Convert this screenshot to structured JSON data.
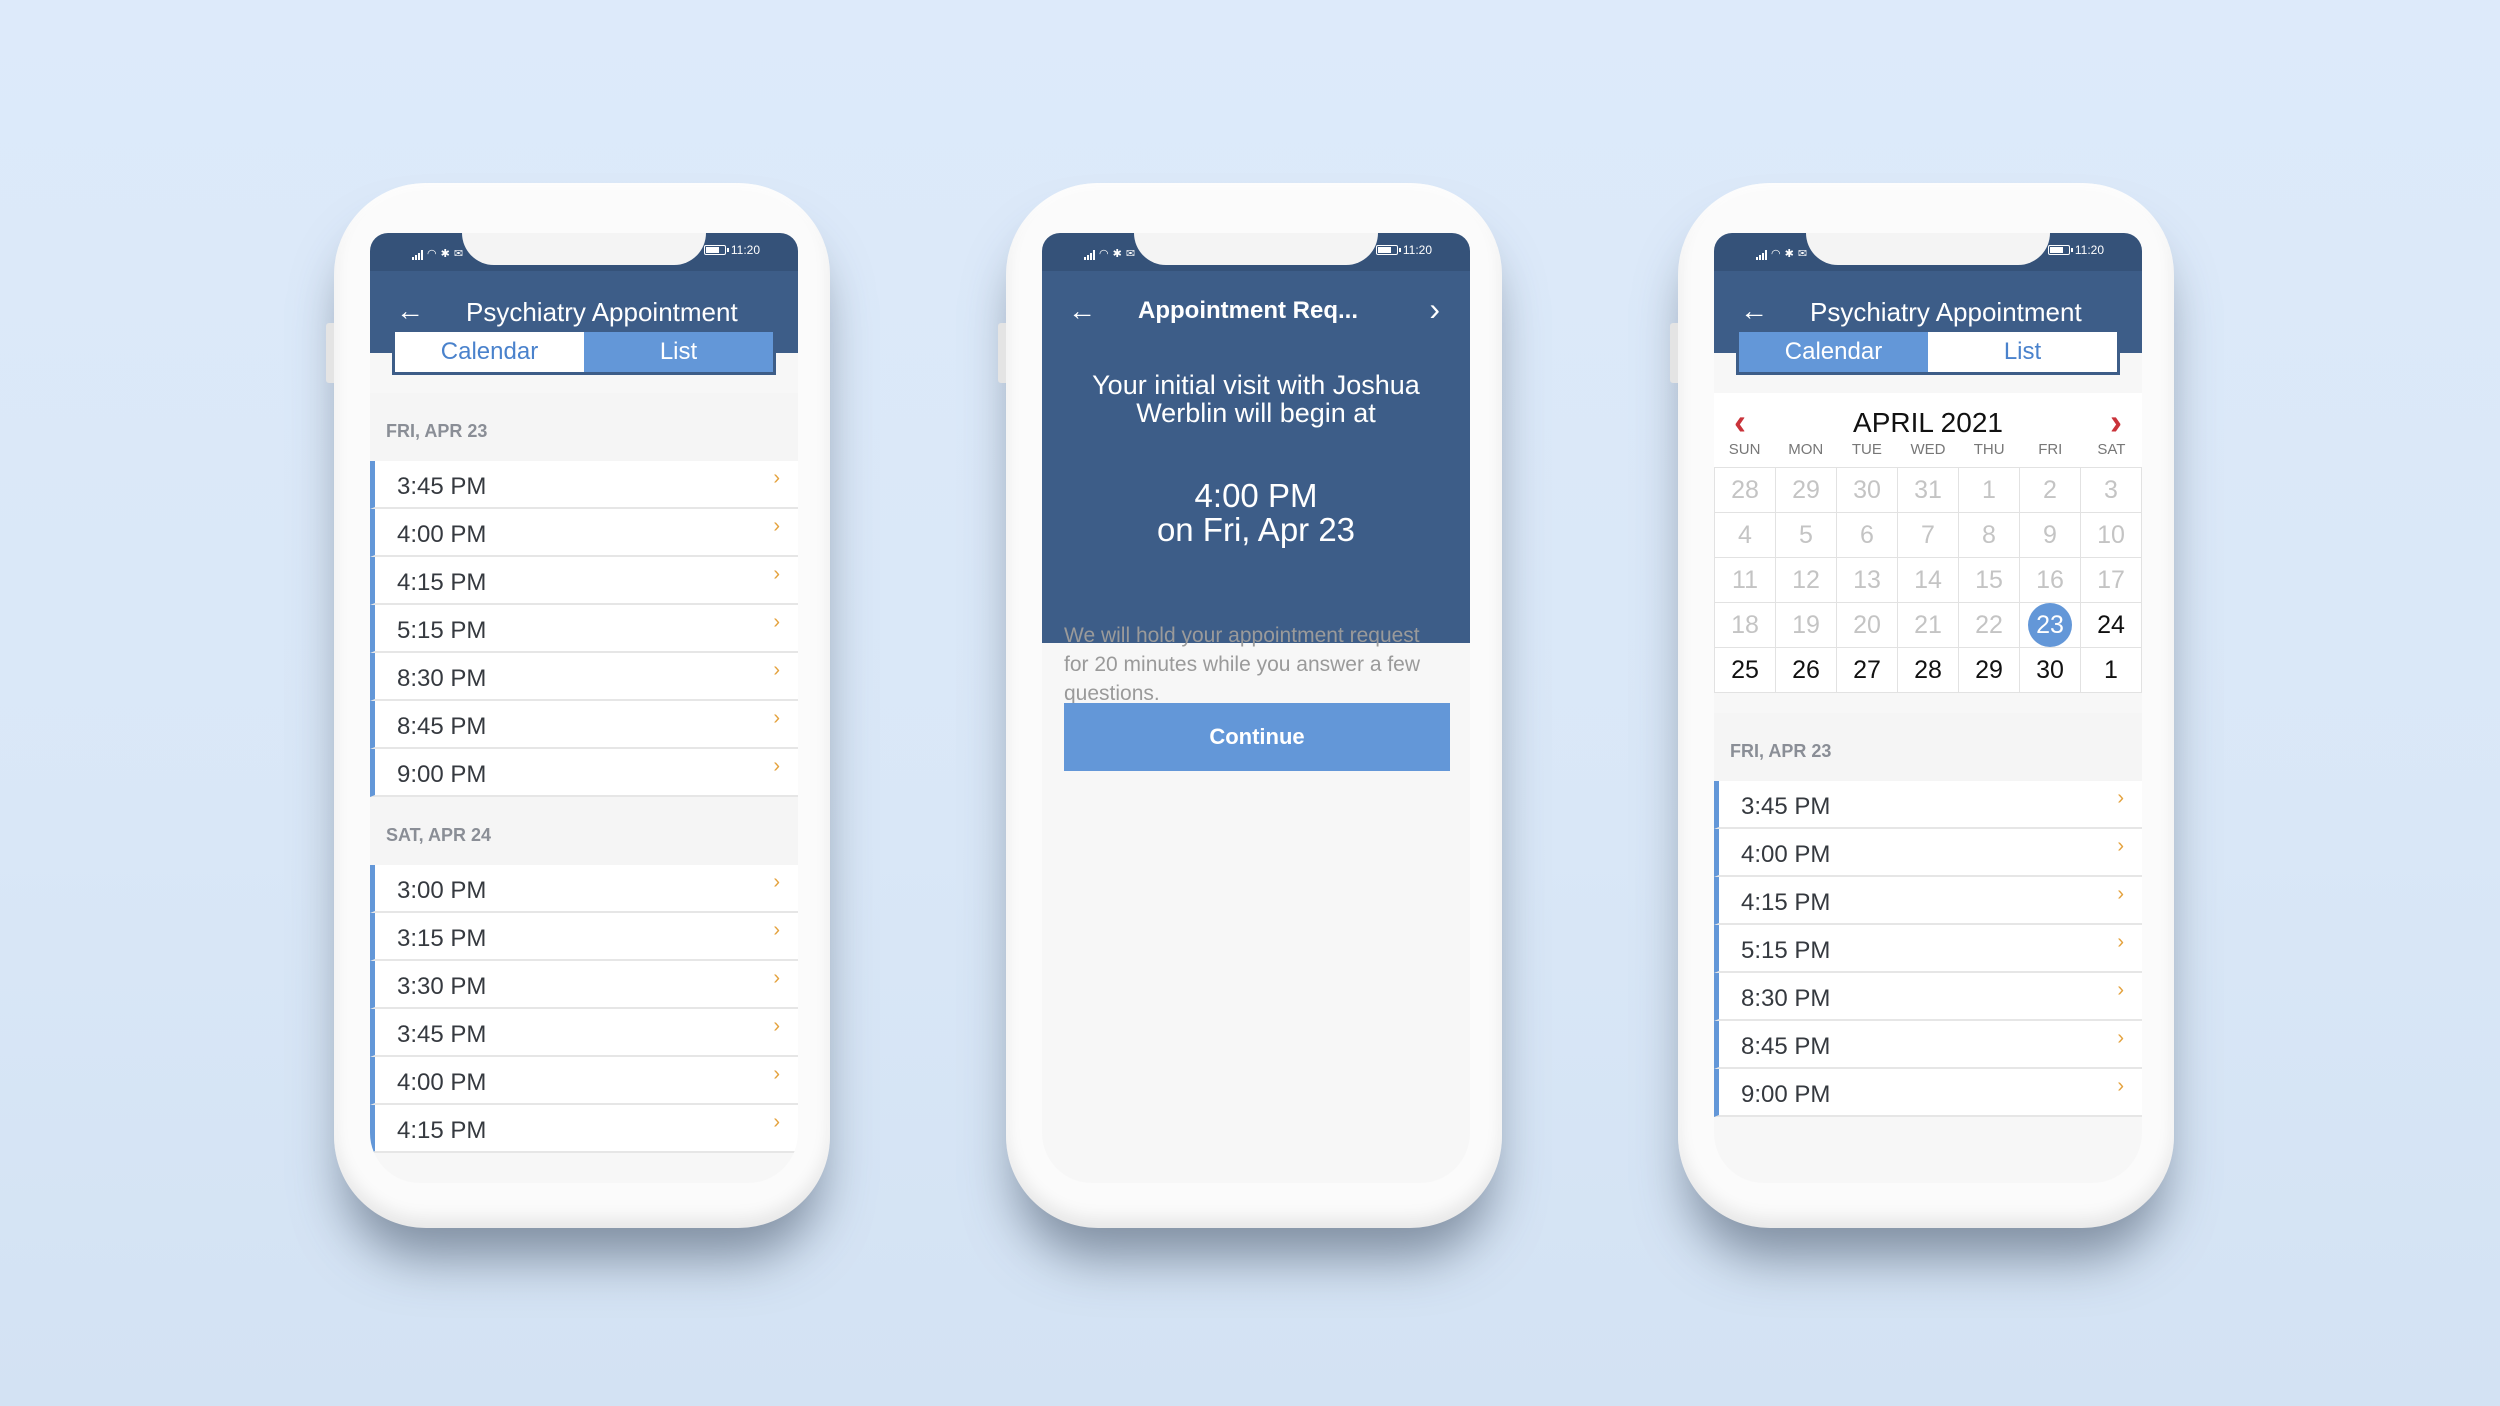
{
  "colors": {
    "header": "#3d5d88",
    "statusbar": "#355279",
    "accent": "#6397d8",
    "chevron": "#e4a23e",
    "calendar_nav": "#c9333a",
    "background": "#dde9f8"
  },
  "status_bar": {
    "time": "11:20",
    "icons_left": [
      "signal-icon",
      "wifi-icon",
      "bluetooth-icon",
      "mail-icon",
      "image-icon"
    ],
    "icons_right": [
      "battery-icon"
    ]
  },
  "phones": {
    "left": {
      "title": "Psychiatry Appointment",
      "back_icon": "back-arrow-icon",
      "segmented": {
        "calendar": "Calendar",
        "list": "List",
        "selected": "List"
      },
      "groups": [
        {
          "date": "FRI, APR 23",
          "slots": [
            "3:45 PM",
            "4:00 PM",
            "4:15 PM",
            "5:15 PM",
            "8:30 PM",
            "8:45 PM",
            "9:00 PM"
          ]
        },
        {
          "date": "SAT, APR 24",
          "slots": [
            "3:00 PM",
            "3:15 PM",
            "3:30 PM",
            "3:45 PM",
            "4:00 PM",
            "4:15 PM"
          ]
        }
      ]
    },
    "middle": {
      "title": "Appointment Req...",
      "back_icon": "back-arrow-icon",
      "forward_icon": "chevron-right-icon",
      "message": "Your initial visit with Joshua Werblin will begin at",
      "time": "4:00 PM",
      "date": "on Fri, Apr 23",
      "hold_text": "We will hold your appointment request for 20 minutes while you answer a few questions.",
      "continue_label": "Continue"
    },
    "right": {
      "title": "Psychiatry Appointment",
      "back_icon": "back-arrow-icon",
      "segmented": {
        "calendar": "Calendar",
        "list": "List",
        "selected": "Calendar"
      },
      "calendar": {
        "month_label": "APRIL 2021",
        "prev_icon": "chevron-left-icon",
        "next_icon": "chevron-right-icon",
        "weekdays": [
          "SUN",
          "MON",
          "TUE",
          "WED",
          "THU",
          "FRI",
          "SAT"
        ],
        "days": [
          {
            "d": "28",
            "s": "off"
          },
          {
            "d": "29",
            "s": "off"
          },
          {
            "d": "30",
            "s": "off"
          },
          {
            "d": "31",
            "s": "off"
          },
          {
            "d": "1",
            "s": "off"
          },
          {
            "d": "2",
            "s": "off"
          },
          {
            "d": "3",
            "s": "off"
          },
          {
            "d": "4",
            "s": "off"
          },
          {
            "d": "5",
            "s": "off"
          },
          {
            "d": "6",
            "s": "off"
          },
          {
            "d": "7",
            "s": "off"
          },
          {
            "d": "8",
            "s": "off"
          },
          {
            "d": "9",
            "s": "off"
          },
          {
            "d": "10",
            "s": "off"
          },
          {
            "d": "11",
            "s": "off"
          },
          {
            "d": "12",
            "s": "off"
          },
          {
            "d": "13",
            "s": "off"
          },
          {
            "d": "14",
            "s": "off"
          },
          {
            "d": "15",
            "s": "off"
          },
          {
            "d": "16",
            "s": "off"
          },
          {
            "d": "17",
            "s": "off"
          },
          {
            "d": "18",
            "s": "off"
          },
          {
            "d": "19",
            "s": "off"
          },
          {
            "d": "20",
            "s": "off"
          },
          {
            "d": "21",
            "s": "off"
          },
          {
            "d": "22",
            "s": "off"
          },
          {
            "d": "23",
            "s": "selected"
          },
          {
            "d": "24",
            "s": "avail"
          },
          {
            "d": "25",
            "s": "avail"
          },
          {
            "d": "26",
            "s": "avail"
          },
          {
            "d": "27",
            "s": "avail"
          },
          {
            "d": "28",
            "s": "avail"
          },
          {
            "d": "29",
            "s": "avail"
          },
          {
            "d": "30",
            "s": "avail"
          },
          {
            "d": "1",
            "s": "avail"
          }
        ]
      },
      "group": {
        "date": "FRI, APR 23",
        "slots": [
          "3:45 PM",
          "4:00 PM",
          "4:15 PM",
          "5:15 PM",
          "8:30 PM",
          "8:45 PM",
          "9:00 PM"
        ]
      }
    }
  }
}
